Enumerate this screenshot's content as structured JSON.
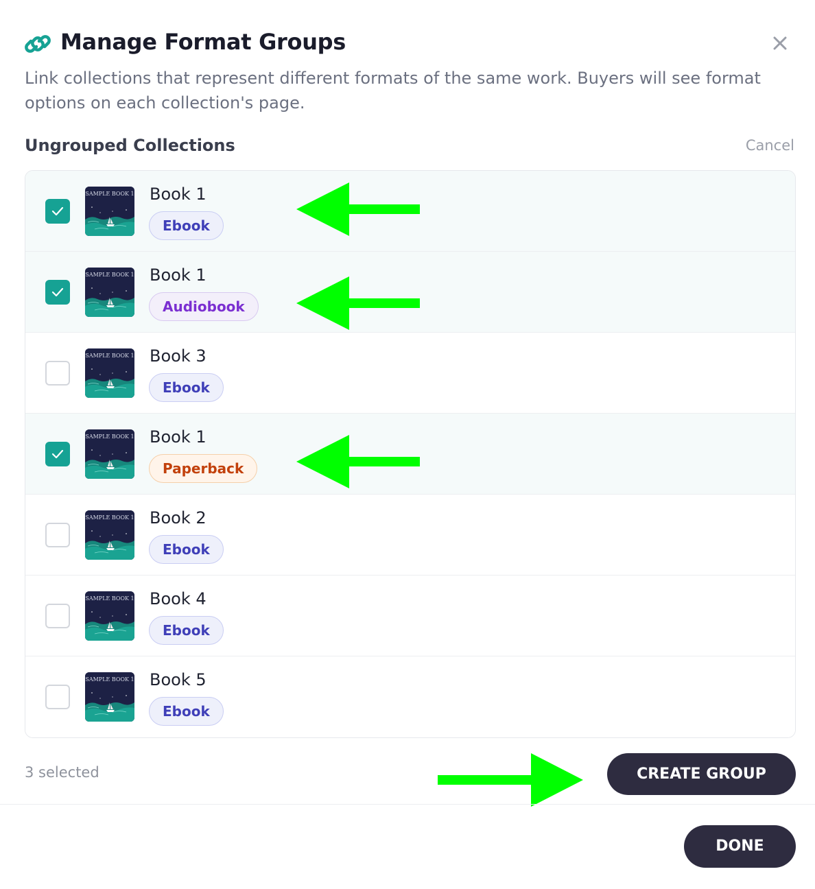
{
  "dialog": {
    "title": "Manage Format Groups",
    "description": "Link collections that represent different formats of the same work. Buyers will see format options on each collection's page.",
    "close_icon": "close-icon",
    "title_icon": "link-icon"
  },
  "section": {
    "title": "Ungrouped Collections",
    "cancel_label": "Cancel"
  },
  "collections": [
    {
      "title": "Book 1",
      "format": "Ebook",
      "checked": true,
      "cover_text": "SAMPLE BOOK 1"
    },
    {
      "title": "Book 1",
      "format": "Audiobook",
      "checked": true,
      "cover_text": "SAMPLE BOOK 1"
    },
    {
      "title": "Book 3",
      "format": "Ebook",
      "checked": false,
      "cover_text": "SAMPLE BOOK 1"
    },
    {
      "title": "Book 1",
      "format": "Paperback",
      "checked": true,
      "cover_text": "SAMPLE BOOK 1"
    },
    {
      "title": "Book 2",
      "format": "Ebook",
      "checked": false,
      "cover_text": "SAMPLE BOOK 1"
    },
    {
      "title": "Book 4",
      "format": "Ebook",
      "checked": false,
      "cover_text": "SAMPLE BOOK 1"
    },
    {
      "title": "Book 5",
      "format": "Ebook",
      "checked": false,
      "cover_text": "SAMPLE BOOK 1"
    }
  ],
  "footer": {
    "selected_count": "3 selected",
    "create_group_label": "CREATE GROUP",
    "done_label": "DONE"
  },
  "colors": {
    "accent": "#16a294",
    "primary_button": "#2e2c40",
    "annotation_arrow": "#00ff00"
  }
}
